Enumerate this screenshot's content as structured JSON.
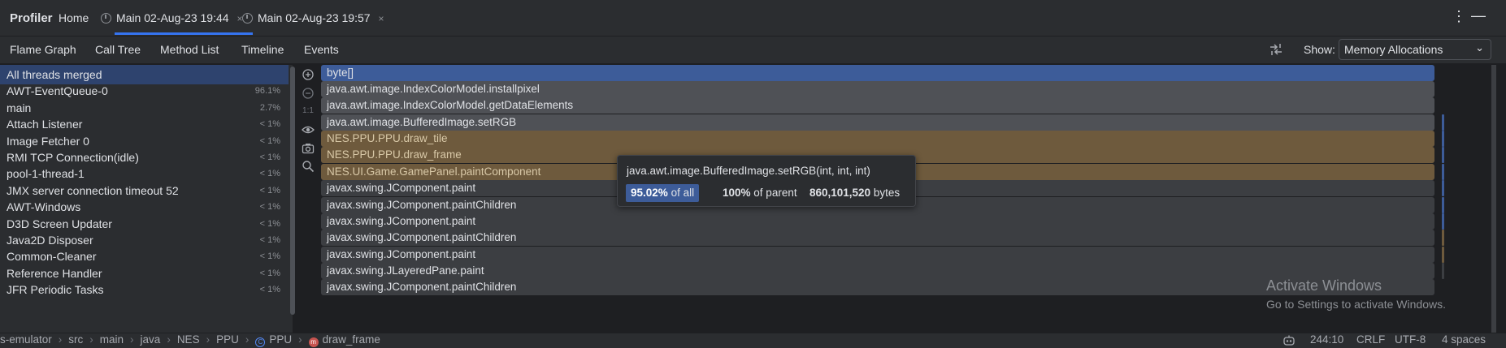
{
  "header": {
    "app_title": "Profiler",
    "tabs": [
      {
        "label": "Home"
      },
      {
        "label": "Main 02-Aug-23 19:44",
        "close": "×"
      },
      {
        "label": "Main 02-Aug-23 19:57",
        "close": "×"
      }
    ],
    "more_icon": "⋮",
    "minimize_icon": "—"
  },
  "view_tabs": [
    "Flame Graph",
    "Call Tree",
    "Method List",
    "Timeline",
    "Events"
  ],
  "show": {
    "label": "Show:",
    "selected": "Memory Allocations"
  },
  "threads": [
    {
      "name": "All threads merged",
      "pct": ""
    },
    {
      "name": "AWT-EventQueue-0",
      "pct": "96.1%"
    },
    {
      "name": "main",
      "pct": "2.7%"
    },
    {
      "name": "Attach Listener",
      "pct": "< 1%"
    },
    {
      "name": "Image Fetcher 0",
      "pct": "< 1%"
    },
    {
      "name": "RMI TCP Connection(idle)",
      "pct": "< 1%"
    },
    {
      "name": "pool-1-thread-1",
      "pct": "< 1%"
    },
    {
      "name": "JMX server connection timeout 52",
      "pct": "< 1%"
    },
    {
      "name": "AWT-Windows",
      "pct": "< 1%"
    },
    {
      "name": "D3D Screen Updater",
      "pct": "< 1%"
    },
    {
      "name": "Java2D Disposer",
      "pct": "< 1%"
    },
    {
      "name": "Common-Cleaner",
      "pct": "< 1%"
    },
    {
      "name": "Reference Handler",
      "pct": "< 1%"
    },
    {
      "name": "JFR Periodic Tasks",
      "pct": "< 1%"
    }
  ],
  "zoom": {
    "reset_label": "1:1"
  },
  "flame_frames": [
    {
      "label": "byte[]",
      "color": "#3d5c99"
    },
    {
      "label": "java.awt.image.IndexColorModel.installpixel",
      "color": "#4f5156"
    },
    {
      "label": "java.awt.image.IndexColorModel.getDataElements",
      "color": "#4f5156"
    },
    {
      "label": "java.awt.image.BufferedImage.setRGB",
      "color": "#4f5156"
    },
    {
      "label": "NES.PPU.PPU.draw_tile",
      "color": "#6e5a3d"
    },
    {
      "label": "NES.PPU.PPU.draw_frame",
      "color": "#6e5a3d"
    },
    {
      "label": "NES.UI.Game.GamePanel.paintComponent",
      "color": "#6e5a3d"
    },
    {
      "label": "javax.swing.JComponent.paint",
      "color": "#3c3e42"
    },
    {
      "label": "javax.swing.JComponent.paintChildren",
      "color": "#3c3e42"
    },
    {
      "label": "javax.swing.JComponent.paint",
      "color": "#3c3e42"
    },
    {
      "label": "javax.swing.JComponent.paintChildren",
      "color": "#3c3e42"
    },
    {
      "label": "javax.swing.JComponent.paint",
      "color": "#3c3e42"
    },
    {
      "label": "javax.swing.JLayeredPane.paint",
      "color": "#3c3e42"
    },
    {
      "label": "javax.swing.JComponent.paintChildren",
      "color": "#3c3e42"
    }
  ],
  "tooltip": {
    "signature": "java.awt.image.BufferedImage.setRGB(int, int, int)",
    "pct_all": "95.02%",
    "pct_all_suffix": "of all",
    "pct_parent": "100%",
    "pct_parent_suffix": "of parent",
    "bytes": "860,101,520",
    "bytes_suffix": "bytes"
  },
  "watermark": {
    "line1": "Activate Windows",
    "line2": "Go to Settings to activate Windows."
  },
  "statusbar": {
    "crumbs": [
      "s-emulator",
      "src",
      "main",
      "java",
      "NES",
      "PPU",
      "PPU",
      "draw_frame"
    ],
    "position": "244:10",
    "line_ending": "CRLF",
    "encoding": "UTF-8",
    "indent": "4 spaces"
  }
}
